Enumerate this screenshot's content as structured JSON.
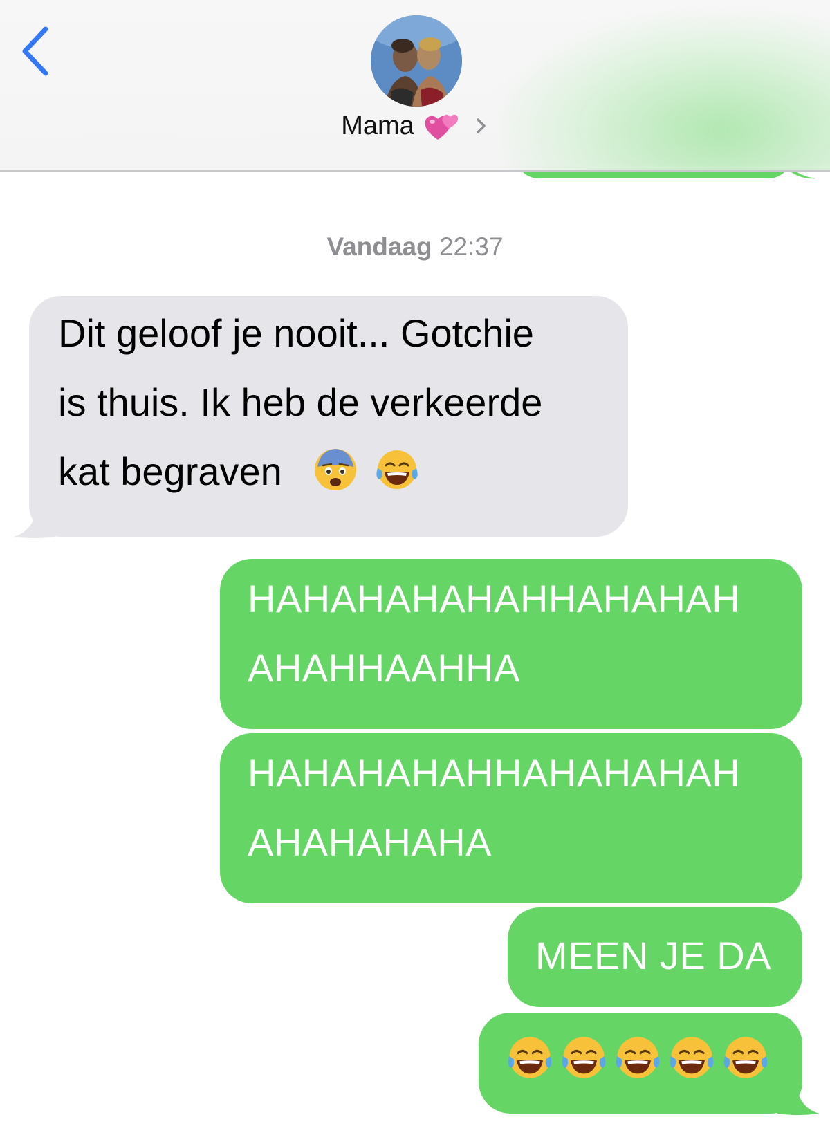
{
  "header": {
    "contact_name": "Mama",
    "avatar_icon": "contact-photo",
    "back_icon": "chevron-left-icon",
    "heart_icon": "two-hearts-icon",
    "chevron_icon": "chevron-right-icon"
  },
  "timestamp": {
    "day": "Vandaag",
    "time": "22:37"
  },
  "messages": {
    "incoming_1": {
      "line1": "Dit geloof je nooit... Gotchie",
      "line2": "is thuis. Ik heb de verkeerde",
      "line3": "kat begraven",
      "emojis": [
        "fearful-face-emoji",
        "tears-of-joy-emoji"
      ]
    },
    "outgoing_1": {
      "line1": "HAHAHAHAHAHHAHAHAH",
      "line2": "AHAHHAAHHA"
    },
    "outgoing_2": {
      "line1": "HAHAHAHAHHAHAHAHAH",
      "line2": "AHAHAHAHA"
    },
    "outgoing_3": {
      "text": "MEEN JE DA"
    },
    "outgoing_4": {
      "emojis": [
        "tears-of-joy-emoji",
        "tears-of-joy-emoji",
        "tears-of-joy-emoji",
        "tears-of-joy-emoji",
        "tears-of-joy-emoji"
      ]
    }
  },
  "colors": {
    "accent_blue": "#3478f6",
    "outgoing_green": "#65d665",
    "incoming_gray": "#e5e5ea",
    "timestamp_gray": "#8e8e93"
  }
}
